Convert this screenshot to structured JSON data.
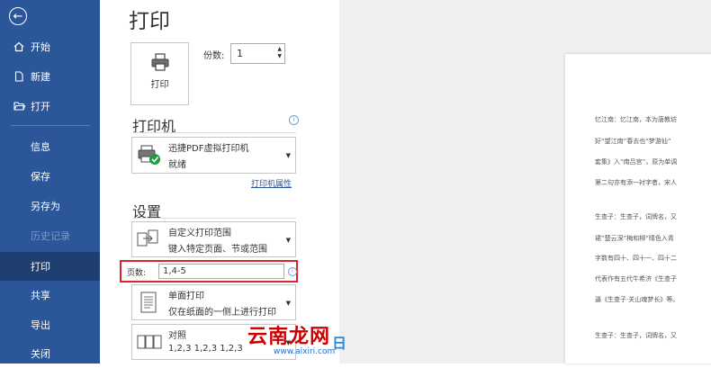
{
  "sidebar": {
    "items": [
      {
        "label": "开始",
        "icon": "home-icon"
      },
      {
        "label": "新建",
        "icon": "new-document-icon"
      },
      {
        "label": "打开",
        "icon": "open-folder-icon"
      },
      {
        "label": "信息"
      },
      {
        "label": "保存"
      },
      {
        "label": "另存为"
      },
      {
        "label": "历史记录"
      },
      {
        "label": "打印"
      },
      {
        "label": "共享"
      },
      {
        "label": "导出"
      },
      {
        "label": "关闭"
      }
    ]
  },
  "main": {
    "title": "打印",
    "print_button": "打印",
    "copies_label": "份数:",
    "copies_value": "1",
    "printer_section": "打印机",
    "printer_name": "迅捷PDF虚拟打印机",
    "printer_status": "就绪",
    "printer_properties": "打印机属性",
    "settings_section": "设置",
    "range_title": "自定义打印范围",
    "range_desc": "键入特定页面、节或范围",
    "pages_label": "页数:",
    "pages_value": "1,4-5",
    "sides_title": "单面打印",
    "sides_desc": "仅在纸面的一侧上进行打印",
    "collate_title": "对照",
    "collate_desc": "1,2,3    1,2,3    1,2,3"
  },
  "preview": {
    "lines": [
      "忆江南：忆江南，本为唐教坊",
      "好“望江南”春去也“梦游仙”",
      "套集》入“南吕宫”，原为单调",
      "第二句亦有添一衬字者，宋人",
      "",
      "生查子：生查子，词牌名，又",
      "裙”楚云深”梅和柳”晴色入青",
      "字数有四十、四十一、四十二",
      "代表作有五代牛希济《生查子",
      "逼《生查子·关山魂梦长》等。",
      "",
      "生查子：生查子，词牌名，又"
    ]
  },
  "watermark": {
    "text": "云南龙网",
    "url": "www.aixiri.com",
    "extra": "日"
  }
}
